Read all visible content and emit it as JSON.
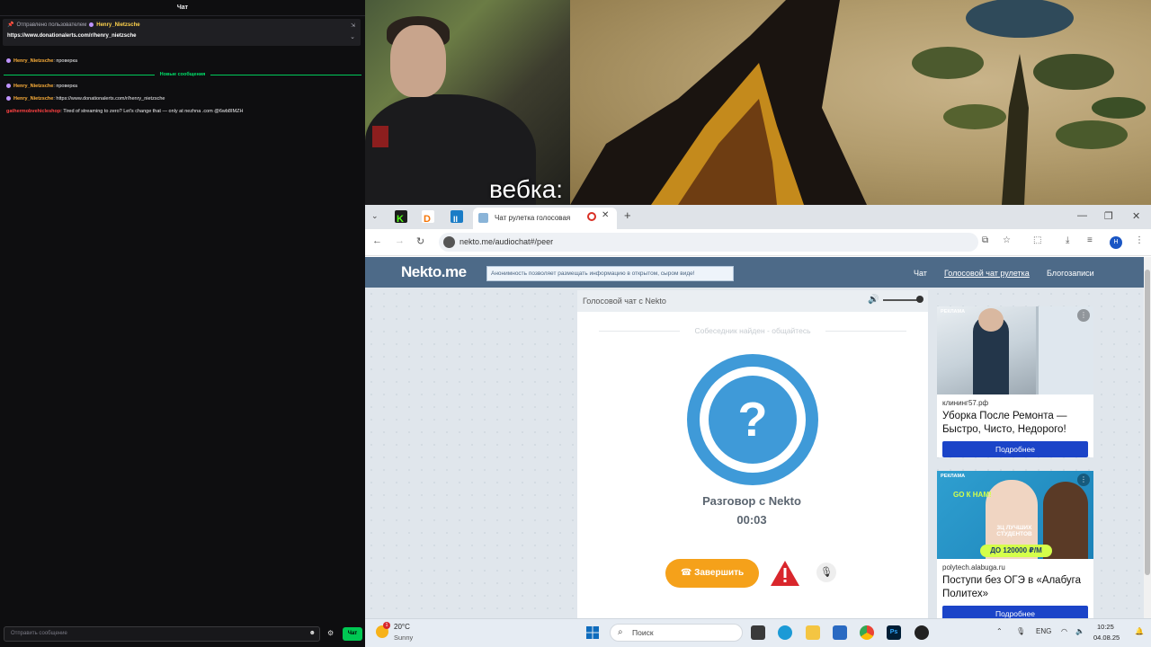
{
  "chat": {
    "title": "Чат",
    "pinned_by_label": "Отправлено пользователем",
    "pinned_by_user": "Henry_Nietzsche",
    "pinned_text": "https://www.donationalerts.com/r/henry_nietzsche",
    "messages": [
      {
        "user": "Henry_Nietzsche",
        "sep": ":",
        "text": "проверка"
      },
      {
        "user": "Henry_Nietzsche",
        "sep": ":",
        "text": "проверка"
      },
      {
        "user": "Henry_Nietzsche",
        "sep": ":",
        "text": "https://www.donationalerts.com/r/henry_nietzsche"
      },
      {
        "user": "gathermobvehicleshop",
        "sep": ":",
        "text": "Tired of streaming to zero? Let's change that — only at nezhna .com @6wb8IMZH"
      }
    ],
    "new_messages_label": "Новые сообщения",
    "input_placeholder": "Отправить сообщение",
    "send_label": "Чат"
  },
  "webcam": {
    "label": "вебка:"
  },
  "browser": {
    "active_tab_title": "Чат рулетка голосовая",
    "url": "nekto.me/audiochat#/peer",
    "avatar_letter": "H",
    "colors": {
      "tabbar": "#dfe3e8",
      "accent": "#1a56c4"
    }
  },
  "site": {
    "logo": "Nekto.me",
    "notice": "Анонимность позволяет размещать информацию в открытом, сыром виде!",
    "nav": [
      "Чат",
      "Голосовой чат рулетка",
      "Блогозаписи"
    ],
    "panel_title": "Голосовой чат с Nekto",
    "status": "Собеседник найден - общайтесь",
    "question_mark": "?",
    "conversation_title": "Разговор с Nekto",
    "timer": "00:03",
    "end_button": "Завершить",
    "colors": {
      "nav": "#4d6a88",
      "circle": "#3f9ad8",
      "end_button": "#f5a11a",
      "warning": "#d9262c"
    }
  },
  "ads": [
    {
      "tag": "РЕКЛАМА",
      "domain": "клининг57.рф",
      "title": "Уборка После Ремонта — Быстро, Чисто, Недорого!",
      "button": "Подробнее"
    },
    {
      "tag": "РЕКЛАМА",
      "domain": "polytech.alabuga.ru",
      "title": "Поступи без ОГЭ в «Алабуга Политех»",
      "button": "Подробнее",
      "image_text_1": "GO К НАМ!",
      "image_text_2": "3Ц ЛУЧШИХ СТУДЕНТОВ",
      "image_text_3": "ДО 120000 ₽/М"
    }
  ],
  "taskbar": {
    "temperature": "20°C",
    "condition": "Sunny",
    "weather_badge": "1",
    "search_placeholder": "Поиск",
    "language": "ENG",
    "time": "10:25",
    "date": "04.08.25"
  }
}
